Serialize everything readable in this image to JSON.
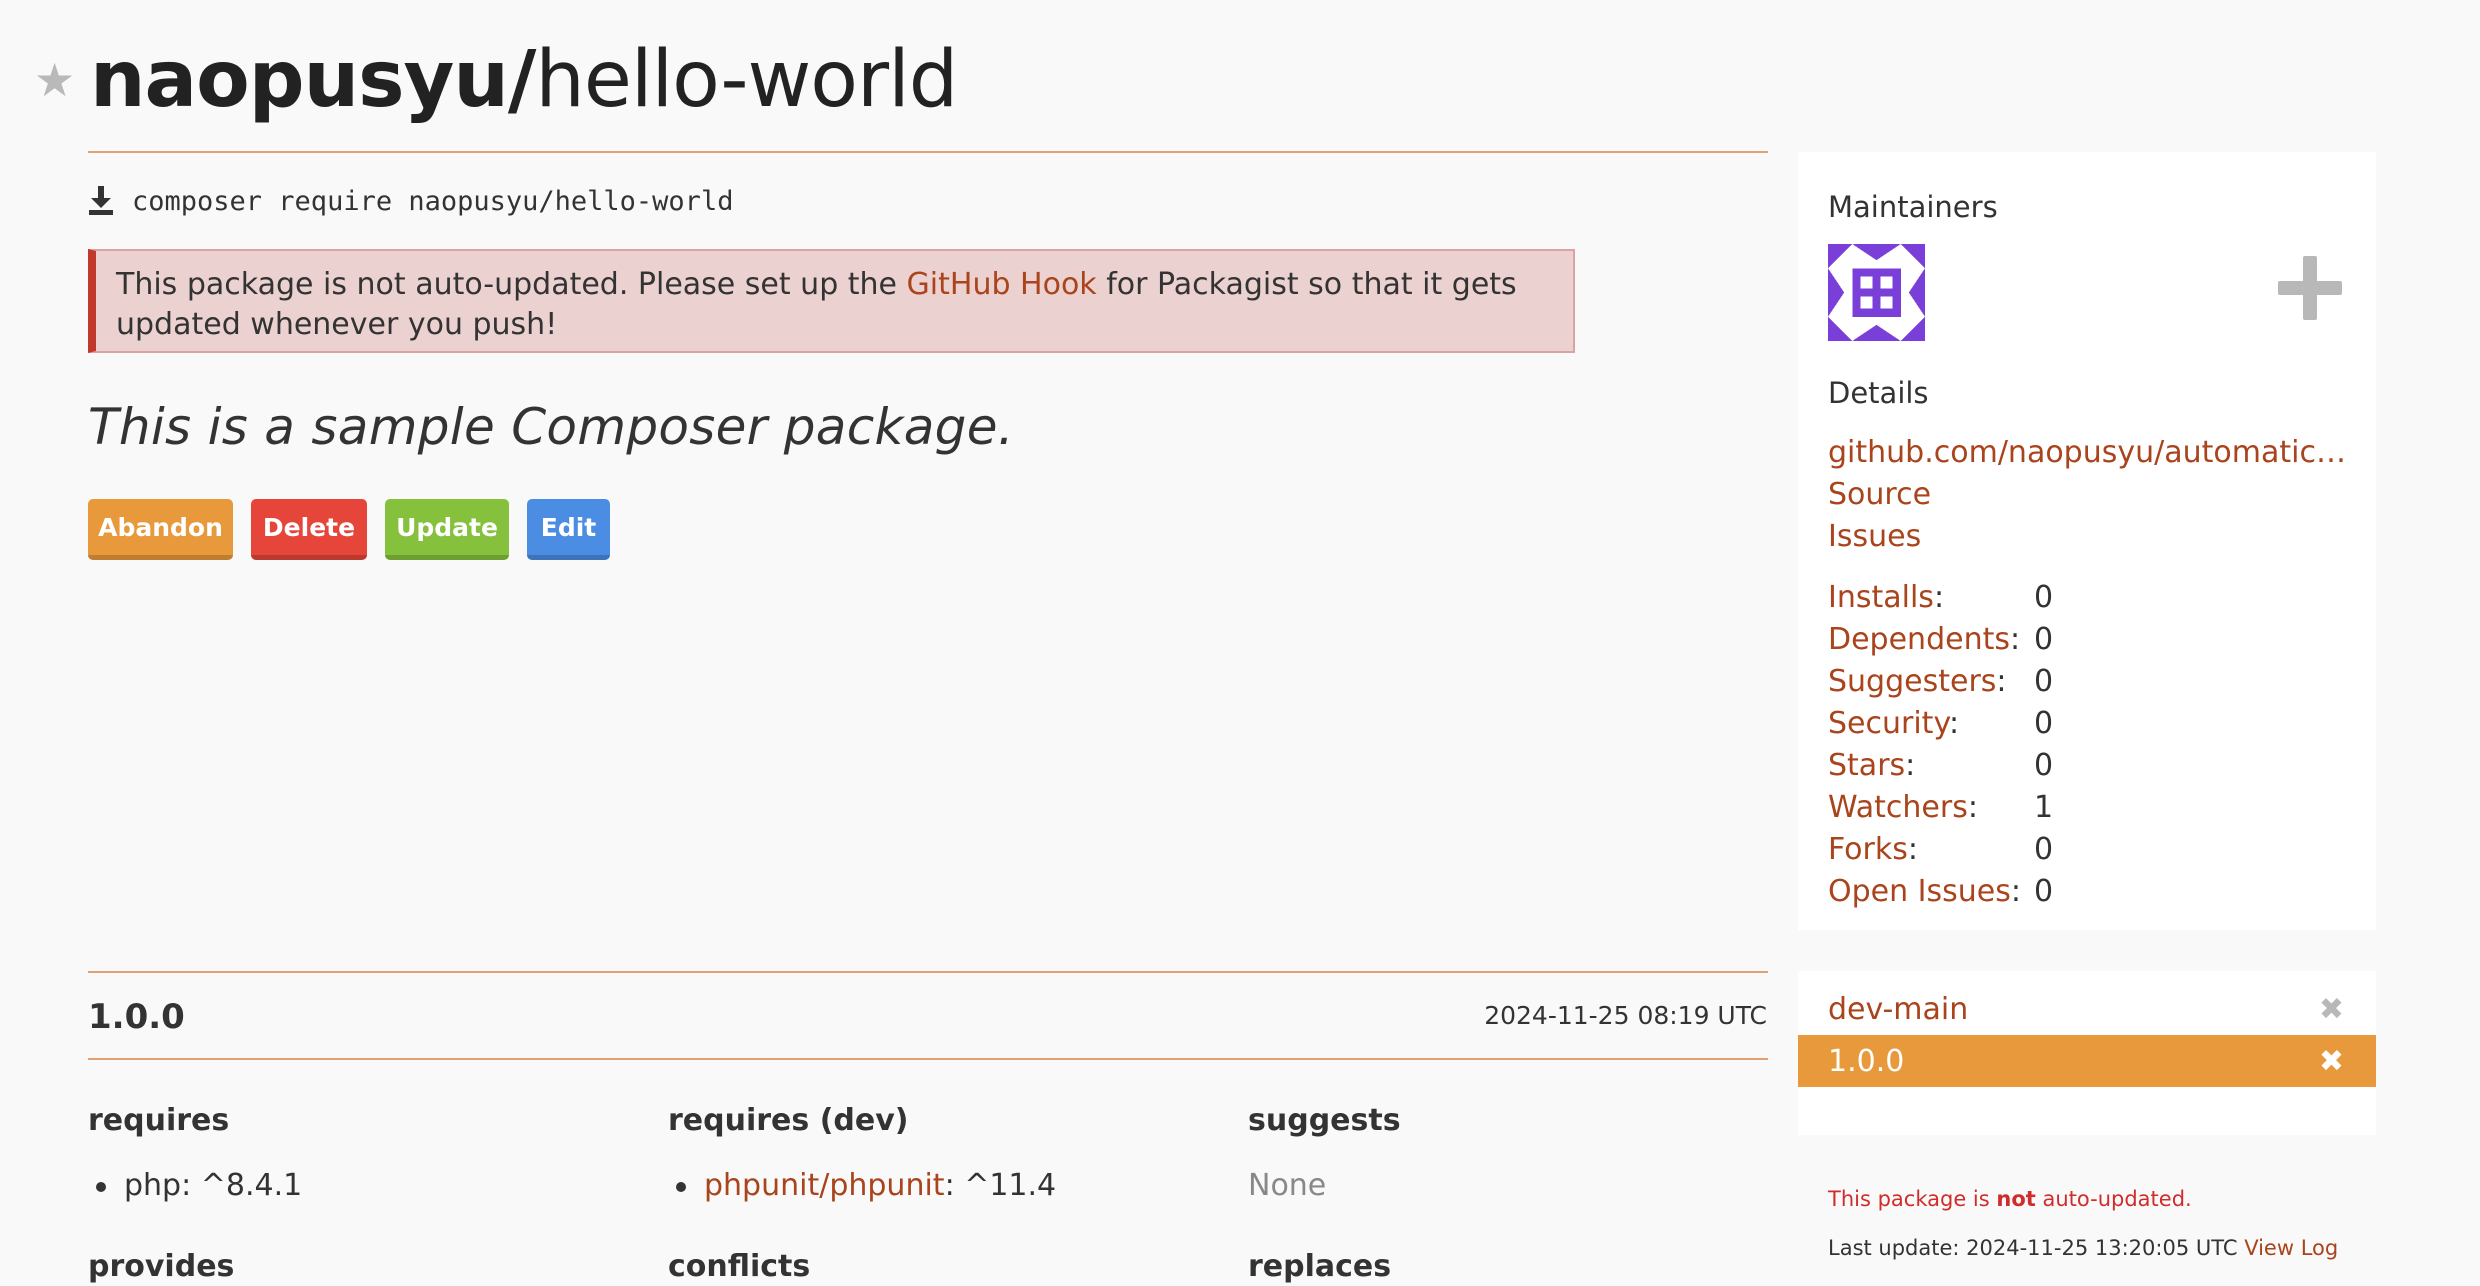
{
  "header": {
    "vendor": "naopusyu/",
    "name": "hello-world"
  },
  "install": {
    "command": "composer require naopusyu/hello-world"
  },
  "alert": {
    "before": "This package is not auto-updated. Please set up the ",
    "link": "GitHub Hook",
    "after": " for Packagist so that it gets updated whenever you push!"
  },
  "description": "This is a sample Composer package.",
  "actions": {
    "abandon": "Abandon",
    "delete": "Delete",
    "update": "Update",
    "edit": "Edit"
  },
  "version": {
    "number": "1.0.0",
    "date": "2024-11-25 08:19 UTC",
    "requires": {
      "heading": "requires",
      "items": [
        {
          "text": "php: ^8.4.1"
        }
      ]
    },
    "requires_dev": {
      "heading": "requires (dev)",
      "items": [
        {
          "link": "phpunit/phpunit",
          "rest": ": ^11.4"
        }
      ]
    },
    "suggests": {
      "heading": "suggests",
      "none": "None"
    },
    "provides": {
      "heading": "provides"
    },
    "conflicts": {
      "heading": "conflicts"
    },
    "replaces": {
      "heading": "replaces"
    }
  },
  "sidebar": {
    "maintainers_label": "Maintainers",
    "details_label": "Details",
    "repo_link": "github.com/naopusyu/automatic-umbrella",
    "source_link": "Source",
    "issues_link": "Issues",
    "stats": [
      {
        "label": "Installs",
        "value": "0"
      },
      {
        "label": "Dependents",
        "value": "0"
      },
      {
        "label": "Suggesters",
        "value": "0"
      },
      {
        "label": "Security",
        "value": "0"
      },
      {
        "label": "Stars",
        "value": "0"
      },
      {
        "label": "Watchers",
        "value": "1"
      },
      {
        "label": "Forks",
        "value": "0"
      },
      {
        "label": "Open Issues",
        "value": "0"
      }
    ],
    "versions": [
      {
        "label": "dev-main",
        "active": false
      },
      {
        "label": "1.0.0",
        "active": true
      }
    ],
    "note": {
      "prefix": "This package is ",
      "strong": "not",
      "suffix": " auto-updated."
    },
    "last_update": {
      "text": "Last update: 2024-11-25 13:20:05 UTC ",
      "link": "View Log"
    }
  },
  "colors": {
    "accent_orange": "#e8993b",
    "link": "#a9441c",
    "danger": "#e6463a",
    "success": "#86c13e",
    "primary": "#4a8de2",
    "avatar": "#7b3fd9"
  },
  "icons": {
    "star": "star-icon",
    "download": "download-icon",
    "add_maintainer": "plus-icon",
    "remove_version": "close-icon"
  }
}
